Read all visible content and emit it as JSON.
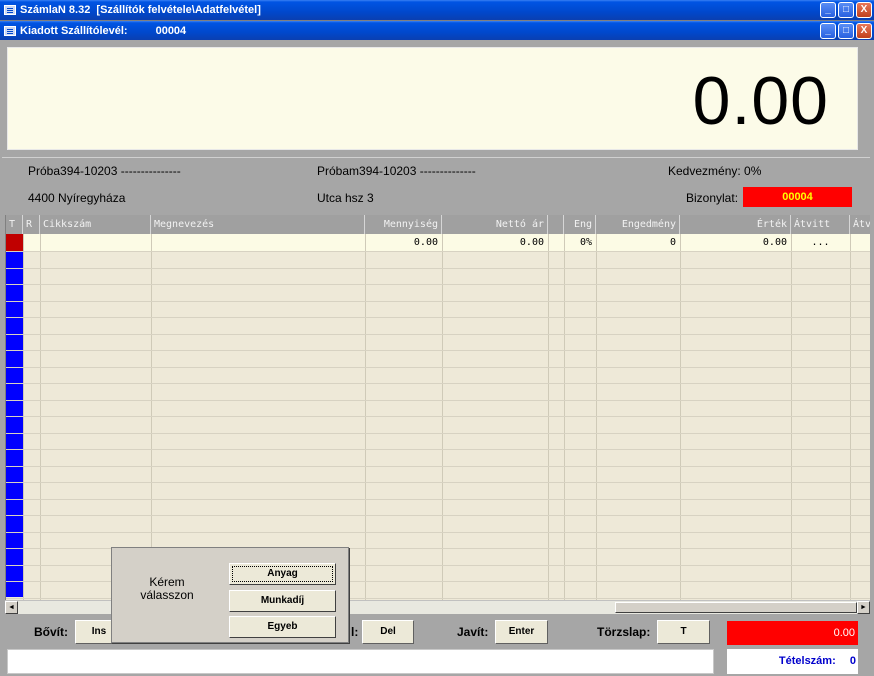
{
  "window": {
    "title": "SzámlaN 8.32  [Szállítók felvétele\\Adatfelvétel]",
    "subtitle_label": "Kiadott Szállítólevél:",
    "subtitle_number": "00004",
    "min_glyph": "_",
    "max_glyph": "□",
    "close_glyph": "X"
  },
  "display": {
    "total": "0.00"
  },
  "partners": {
    "left_name": "Próba394-10203 ---------------",
    "left_address": "4400 Nyíregyháza",
    "right_name": "Próbam394-10203 --------------",
    "right_address": "Utca hsz 3"
  },
  "discount": {
    "label": "Kedvezmény:",
    "value": "0%"
  },
  "document": {
    "label": "Bizonylat:",
    "value": "00004"
  },
  "grid": {
    "headers": [
      "T",
      "R",
      "Cikkszám",
      "Megnevezés",
      "Mennyiség",
      "Nettó ár",
      "",
      "Eng",
      "Engedmény",
      "Érték",
      "Átvitt",
      "Átv"
    ],
    "first_row": {
      "quantity": "0.00",
      "net_price": "0.00",
      "eng": "0%",
      "discount": "0",
      "value": "0.00",
      "transferred": "..."
    }
  },
  "toolbar": {
    "expand_label": "Bővít:",
    "expand_key": "Ins",
    "delete_label": "l:",
    "delete_key": "Del",
    "edit_label": "Javít:",
    "edit_key": "Enter",
    "master_label": "Törzslap:",
    "master_key": "T",
    "total": "0.00",
    "item_count_label": "Tételszám:",
    "item_count_value": "0"
  },
  "popup": {
    "prompt_line1": "Kérem",
    "prompt_line2": "válasszon",
    "options": [
      "Anyag",
      "Munkadíj",
      "Egyeb"
    ]
  },
  "scroll": {
    "left": "◄",
    "right": "►"
  },
  "colors": {
    "title_blue": "#0048cc",
    "grid_bg": "#eee9d8",
    "alert_red": "#ff0000",
    "selected_row_marker": "#c00000"
  }
}
